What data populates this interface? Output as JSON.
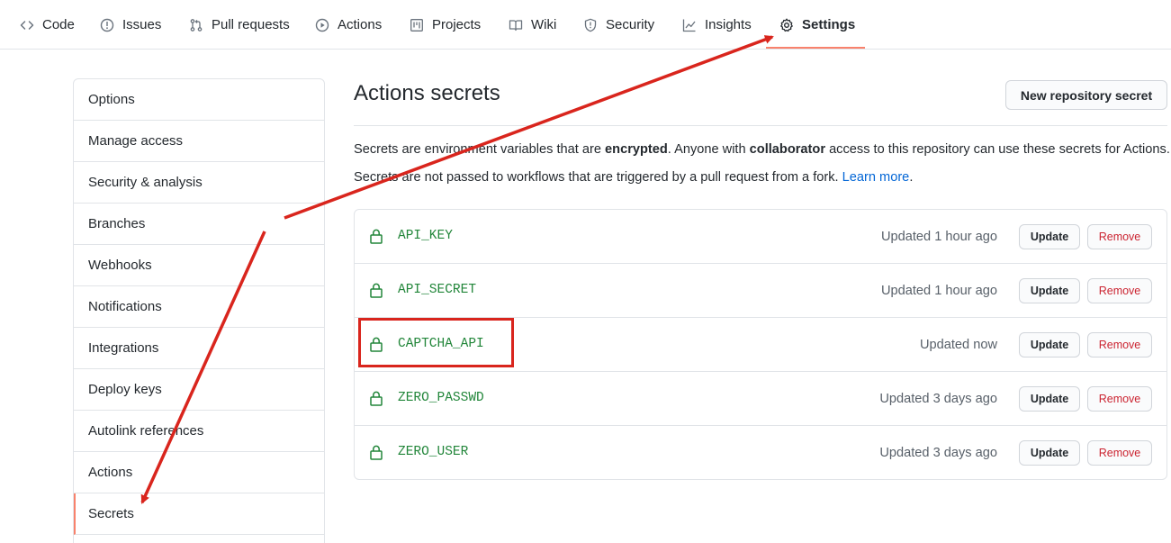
{
  "topnav": {
    "tabs": [
      {
        "label": "Code",
        "icon": "code-icon"
      },
      {
        "label": "Issues",
        "icon": "issue-opened-icon"
      },
      {
        "label": "Pull requests",
        "icon": "git-pull-request-icon"
      },
      {
        "label": "Actions",
        "icon": "play-icon"
      },
      {
        "label": "Projects",
        "icon": "project-icon"
      },
      {
        "label": "Wiki",
        "icon": "book-icon"
      },
      {
        "label": "Security",
        "icon": "shield-icon"
      },
      {
        "label": "Insights",
        "icon": "graph-icon"
      },
      {
        "label": "Settings",
        "icon": "gear-icon",
        "selected": true
      }
    ]
  },
  "sidebar": {
    "items": [
      {
        "label": "Options"
      },
      {
        "label": "Manage access"
      },
      {
        "label": "Security & analysis"
      },
      {
        "label": "Branches"
      },
      {
        "label": "Webhooks"
      },
      {
        "label": "Notifications"
      },
      {
        "label": "Integrations"
      },
      {
        "label": "Deploy keys"
      },
      {
        "label": "Autolink references"
      },
      {
        "label": "Actions"
      },
      {
        "label": "Secrets",
        "active": true
      }
    ]
  },
  "main": {
    "title": "Actions secrets",
    "new_secret_label": "New repository secret",
    "desc1": {
      "p1": "Secrets are environment variables that are ",
      "b1": "encrypted",
      "p2": ". Anyone with ",
      "b2": "collaborator",
      "p3": " access to this repository can use these secrets for Actions."
    },
    "desc2": {
      "p1": "Secrets are not passed to workflows that are triggered by a pull request from a fork. ",
      "link": "Learn more",
      "p2": "."
    },
    "secrets": [
      {
        "name": "API_KEY",
        "updated": "Updated 1 hour ago"
      },
      {
        "name": "API_SECRET",
        "updated": "Updated 1 hour ago"
      },
      {
        "name": "CAPTCHA_API",
        "updated": "Updated now"
      },
      {
        "name": "ZERO_PASSWD",
        "updated": "Updated 3 days ago"
      },
      {
        "name": "ZERO_USER",
        "updated": "Updated 3 days ago"
      }
    ],
    "update_label": "Update",
    "remove_label": "Remove"
  },
  "colors": {
    "accent_underline": "#f9826c",
    "secret_green": "#22863a",
    "remove_red": "#cb2431",
    "link_blue": "#0366d6",
    "annotation_red": "#d9251d"
  }
}
